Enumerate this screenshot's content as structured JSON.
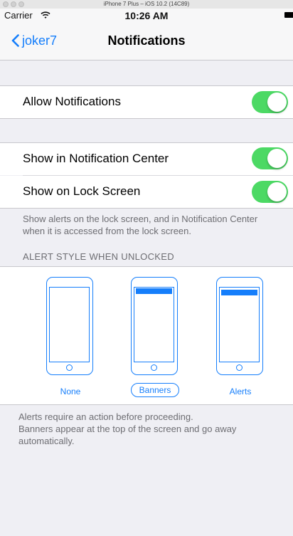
{
  "simulator": {
    "title": "iPhone 7 Plus – iOS 10.2 (14C89)"
  },
  "status_bar": {
    "carrier": "Carrier",
    "time": "10:26 AM"
  },
  "nav": {
    "back_label": "joker7",
    "title": "Notifications"
  },
  "settings": {
    "allow_notifications": {
      "label": "Allow Notifications",
      "on": true
    },
    "show_in_center": {
      "label": "Show in Notification Center",
      "on": true
    },
    "show_on_lock": {
      "label": "Show on Lock Screen",
      "on": true
    },
    "lock_footer": "Show alerts on the lock screen, and in Notification Center when it is accessed from the lock screen."
  },
  "alert_style": {
    "header": "ALERT STYLE WHEN UNLOCKED",
    "options": [
      {
        "label": "None",
        "selected": false
      },
      {
        "label": "Banners",
        "selected": true
      },
      {
        "label": "Alerts",
        "selected": false
      }
    ],
    "footer": "Alerts require an action before proceeding.\nBanners appear at the top of the screen and go away automatically."
  },
  "colors": {
    "accent": "#157efb",
    "toggle_on": "#4cd964",
    "background": "#efeff4"
  }
}
